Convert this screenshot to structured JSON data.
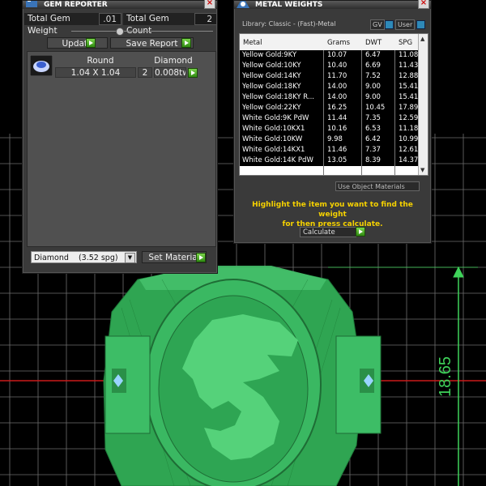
{
  "colors": {
    "viewport_bg": "#000000",
    "grid": "#6e6e6e",
    "model_green": "#35b85a",
    "dimension": "#3fd35a",
    "accent_go": "#4fb82a",
    "hint_yellow": "#f5d100"
  },
  "gem_reporter": {
    "title": "GEM REPORTER",
    "total_weight_label": "Total Gem Weight",
    "total_weight_value": ".01",
    "total_count_label": "Total Gem Count",
    "total_count_value": "2",
    "update_label": "Update",
    "save_report_label": "Save Report",
    "gem_headers": {
      "cut": "Round",
      "material": "Diamond"
    },
    "gem_row": {
      "size": "1.04 X 1.04",
      "qty": "2",
      "weight": "0.008tw"
    },
    "material_dropdown": "Diamond    (3.52 spg)",
    "set_material_label": "Set Material"
  },
  "metal_weights": {
    "title": "METAL WEIGHTS",
    "library": "Library: Classic - (Fast)-Metal",
    "gv_label": "GV",
    "user_label": "User",
    "columns": [
      "Metal",
      "Grams",
      "DWT",
      "SPG"
    ],
    "rows": [
      [
        "Yellow Gold:9KY",
        "10.07",
        "6.47",
        "11.08"
      ],
      [
        "Yellow Gold:10KY",
        "10.40",
        "6.69",
        "11.43"
      ],
      [
        "Yellow Gold:14KY",
        "11.70",
        "7.52",
        "12.88"
      ],
      [
        "Yellow Gold:18KY",
        "14.00",
        "9.00",
        "15.41"
      ],
      [
        "Yellow Gold:18KY R...",
        "14.00",
        "9.00",
        "15.41"
      ],
      [
        "Yellow Gold:22KY",
        "16.25",
        "10.45",
        "17.89"
      ],
      [
        "White Gold:9K PdW",
        "11.44",
        "7.35",
        "12.59"
      ],
      [
        "White Gold:10KX1",
        "10.16",
        "6.53",
        "11.18"
      ],
      [
        "White Gold:10KW",
        "9.98",
        "6.42",
        "10.99"
      ],
      [
        "White Gold:14KX1",
        "11.46",
        "7.37",
        "12.61"
      ],
      [
        "White Gold:14K PdW",
        "13.05",
        "8.39",
        "14.37"
      ]
    ],
    "use_object_materials": "Use Object Materials",
    "hint_line1": "Highlight the item you want to find the weight",
    "hint_line2": "for then press calculate.",
    "calculate_label": "Calculate"
  },
  "viewport": {
    "dimension_label": "18.65"
  }
}
